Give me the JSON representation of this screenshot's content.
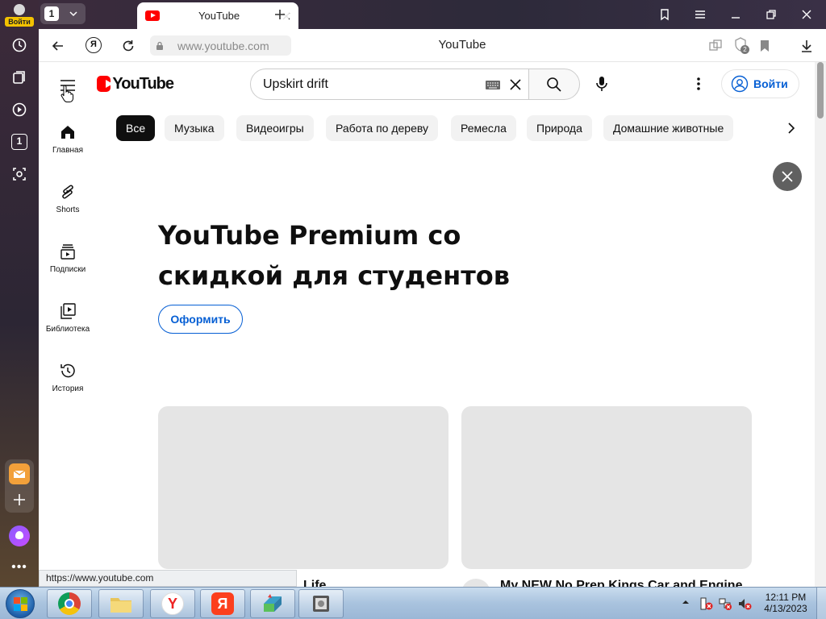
{
  "browser": {
    "profile_badge": "Войти",
    "tab_group_count": "1",
    "tab_title": "YouTube",
    "address_url": "www.youtube.com",
    "page_title": "YouTube",
    "downloads_badge": "2",
    "rail_tab_badge": "1",
    "status_url": "https://www.youtube.com"
  },
  "youtube": {
    "search_value": "Upskirt drift",
    "signin_label": "Войти",
    "logo_text": "YouTube",
    "nav": [
      {
        "label": "Главная",
        "icon": "home-icon"
      },
      {
        "label": "Shorts",
        "icon": "shorts-icon"
      },
      {
        "label": "Подписки",
        "icon": "subscriptions-icon"
      },
      {
        "label": "Библиотека",
        "icon": "library-icon"
      },
      {
        "label": "История",
        "icon": "history-icon"
      }
    ],
    "chips": [
      "Все",
      "Музыка",
      "Видеоигры",
      "Работа по дереву",
      "Ремесла",
      "Природа",
      "Домашние животные"
    ],
    "promo": {
      "title_line1": "YouTube Premium со",
      "title_line2": "скидкой для студентов",
      "button": "Оформить"
    },
    "videos": [
      {
        "title": "Life"
      },
      {
        "title": "My NEW No Prep Kings Car and Engine"
      }
    ]
  },
  "taskbar": {
    "time": "12:11 PM",
    "date": "4/13/2023",
    "apps": [
      "chrome",
      "file-explorer",
      "yandex-browser",
      "yandex",
      "app",
      "app-2"
    ]
  },
  "colors": {
    "youtube_red": "#ff0000",
    "link_blue": "#065fd4",
    "chip_active": "#0f0f0f"
  }
}
